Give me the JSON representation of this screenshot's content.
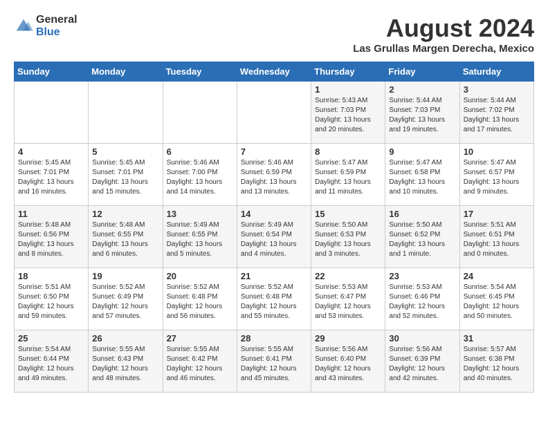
{
  "header": {
    "logo_general": "General",
    "logo_blue": "Blue",
    "month_year": "August 2024",
    "location": "Las Grullas Margen Derecha, Mexico"
  },
  "weekdays": [
    "Sunday",
    "Monday",
    "Tuesday",
    "Wednesday",
    "Thursday",
    "Friday",
    "Saturday"
  ],
  "weeks": [
    [
      {
        "day": "",
        "info": ""
      },
      {
        "day": "",
        "info": ""
      },
      {
        "day": "",
        "info": ""
      },
      {
        "day": "",
        "info": ""
      },
      {
        "day": "1",
        "info": "Sunrise: 5:43 AM\nSunset: 7:03 PM\nDaylight: 13 hours\nand 20 minutes."
      },
      {
        "day": "2",
        "info": "Sunrise: 5:44 AM\nSunset: 7:03 PM\nDaylight: 13 hours\nand 19 minutes."
      },
      {
        "day": "3",
        "info": "Sunrise: 5:44 AM\nSunset: 7:02 PM\nDaylight: 13 hours\nand 17 minutes."
      }
    ],
    [
      {
        "day": "4",
        "info": "Sunrise: 5:45 AM\nSunset: 7:01 PM\nDaylight: 13 hours\nand 16 minutes."
      },
      {
        "day": "5",
        "info": "Sunrise: 5:45 AM\nSunset: 7:01 PM\nDaylight: 13 hours\nand 15 minutes."
      },
      {
        "day": "6",
        "info": "Sunrise: 5:46 AM\nSunset: 7:00 PM\nDaylight: 13 hours\nand 14 minutes."
      },
      {
        "day": "7",
        "info": "Sunrise: 5:46 AM\nSunset: 6:59 PM\nDaylight: 13 hours\nand 13 minutes."
      },
      {
        "day": "8",
        "info": "Sunrise: 5:47 AM\nSunset: 6:59 PM\nDaylight: 13 hours\nand 11 minutes."
      },
      {
        "day": "9",
        "info": "Sunrise: 5:47 AM\nSunset: 6:58 PM\nDaylight: 13 hours\nand 10 minutes."
      },
      {
        "day": "10",
        "info": "Sunrise: 5:47 AM\nSunset: 6:57 PM\nDaylight: 13 hours\nand 9 minutes."
      }
    ],
    [
      {
        "day": "11",
        "info": "Sunrise: 5:48 AM\nSunset: 6:56 PM\nDaylight: 13 hours\nand 8 minutes."
      },
      {
        "day": "12",
        "info": "Sunrise: 5:48 AM\nSunset: 6:55 PM\nDaylight: 13 hours\nand 6 minutes."
      },
      {
        "day": "13",
        "info": "Sunrise: 5:49 AM\nSunset: 6:55 PM\nDaylight: 13 hours\nand 5 minutes."
      },
      {
        "day": "14",
        "info": "Sunrise: 5:49 AM\nSunset: 6:54 PM\nDaylight: 13 hours\nand 4 minutes."
      },
      {
        "day": "15",
        "info": "Sunrise: 5:50 AM\nSunset: 6:53 PM\nDaylight: 13 hours\nand 3 minutes."
      },
      {
        "day": "16",
        "info": "Sunrise: 5:50 AM\nSunset: 6:52 PM\nDaylight: 13 hours\nand 1 minute."
      },
      {
        "day": "17",
        "info": "Sunrise: 5:51 AM\nSunset: 6:51 PM\nDaylight: 13 hours\nand 0 minutes."
      }
    ],
    [
      {
        "day": "18",
        "info": "Sunrise: 5:51 AM\nSunset: 6:50 PM\nDaylight: 12 hours\nand 59 minutes."
      },
      {
        "day": "19",
        "info": "Sunrise: 5:52 AM\nSunset: 6:49 PM\nDaylight: 12 hours\nand 57 minutes."
      },
      {
        "day": "20",
        "info": "Sunrise: 5:52 AM\nSunset: 6:48 PM\nDaylight: 12 hours\nand 56 minutes."
      },
      {
        "day": "21",
        "info": "Sunrise: 5:52 AM\nSunset: 6:48 PM\nDaylight: 12 hours\nand 55 minutes."
      },
      {
        "day": "22",
        "info": "Sunrise: 5:53 AM\nSunset: 6:47 PM\nDaylight: 12 hours\nand 53 minutes."
      },
      {
        "day": "23",
        "info": "Sunrise: 5:53 AM\nSunset: 6:46 PM\nDaylight: 12 hours\nand 52 minutes."
      },
      {
        "day": "24",
        "info": "Sunrise: 5:54 AM\nSunset: 6:45 PM\nDaylight: 12 hours\nand 50 minutes."
      }
    ],
    [
      {
        "day": "25",
        "info": "Sunrise: 5:54 AM\nSunset: 6:44 PM\nDaylight: 12 hours\nand 49 minutes."
      },
      {
        "day": "26",
        "info": "Sunrise: 5:55 AM\nSunset: 6:43 PM\nDaylight: 12 hours\nand 48 minutes."
      },
      {
        "day": "27",
        "info": "Sunrise: 5:55 AM\nSunset: 6:42 PM\nDaylight: 12 hours\nand 46 minutes."
      },
      {
        "day": "28",
        "info": "Sunrise: 5:55 AM\nSunset: 6:41 PM\nDaylight: 12 hours\nand 45 minutes."
      },
      {
        "day": "29",
        "info": "Sunrise: 5:56 AM\nSunset: 6:40 PM\nDaylight: 12 hours\nand 43 minutes."
      },
      {
        "day": "30",
        "info": "Sunrise: 5:56 AM\nSunset: 6:39 PM\nDaylight: 12 hours\nand 42 minutes."
      },
      {
        "day": "31",
        "info": "Sunrise: 5:57 AM\nSunset: 6:38 PM\nDaylight: 12 hours\nand 40 minutes."
      }
    ]
  ]
}
